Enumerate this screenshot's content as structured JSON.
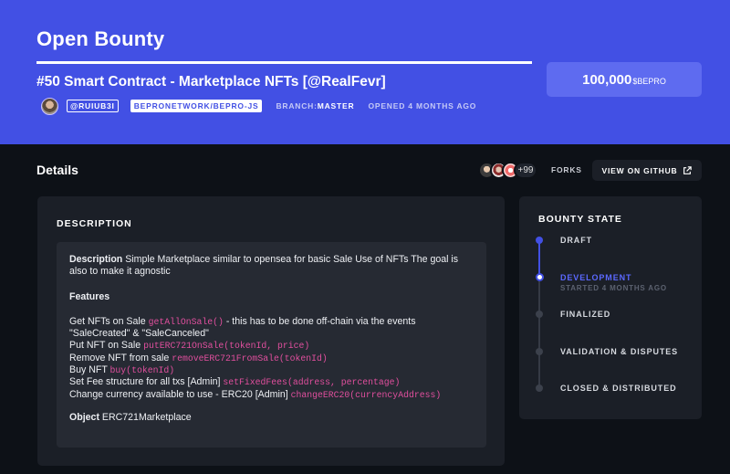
{
  "header": {
    "page_title": "Open Bounty",
    "bounty_title": "#50 Smart Contract - Marketplace NFTs [@RealFevr]",
    "author_handle": "@RUIUB3I",
    "repo": "BEPRONETWORK/BEPRO-JS",
    "branch_label": "BRANCH:",
    "branch_value": "MASTER",
    "opened": "OPENED 4 MONTHS AGO",
    "amount": "100,000",
    "currency": "$BEPRO"
  },
  "details": {
    "title": "Details",
    "forks_more": "+99",
    "forks_label": "FORKS",
    "github_button": "VIEW ON GITHUB"
  },
  "description": {
    "heading": "DESCRIPTION",
    "intro_label": "Description",
    "intro_text": " Simple Marketplace similar to opensea for basic Sale Use of NFTs The goal is also to make it agnostic",
    "features_label": "Features",
    "features": [
      {
        "text": "Get NFTs on Sale ",
        "code": "getAllOnSale()",
        "after": " - this has to be done off-chain via the events \"SaleCreated\" & \"SaleCanceled\""
      },
      {
        "text": "Put NFT on Sale ",
        "code": "putERC721OnSale(tokenId, price)",
        "after": ""
      },
      {
        "text": "Remove NFT from sale ",
        "code": "removeERC721FromSale(tokenId)",
        "after": ""
      },
      {
        "text": "Buy NFT ",
        "code": "buy(tokenId)",
        "after": ""
      },
      {
        "text": "Set Fee structure for all txs [Admin] ",
        "code": "setFixedFees(address, percentage)",
        "after": ""
      },
      {
        "text": "Change currency available to use - ERC20 [Admin] ",
        "code": "changeERC20(currencyAddress)",
        "after": ""
      }
    ],
    "object_label": "Object",
    "object_value": " ERC721Marketplace"
  },
  "bounty_state": {
    "heading": "BOUNTY STATE",
    "steps": [
      {
        "label": "DRAFT",
        "status": "done"
      },
      {
        "label": "DEVELOPMENT",
        "status": "current",
        "sub": "STARTED 4 MONTHS AGO"
      },
      {
        "label": "FINALIZED",
        "status": "pending"
      },
      {
        "label": "VALIDATION & DISPUTES",
        "status": "pending"
      },
      {
        "label": "CLOSED & DISTRIBUTED",
        "status": "pending"
      }
    ]
  },
  "colors": {
    "brand": "#4250e4",
    "code": "#e14f9e",
    "background": "#0d1117",
    "card": "#1b1f27"
  }
}
